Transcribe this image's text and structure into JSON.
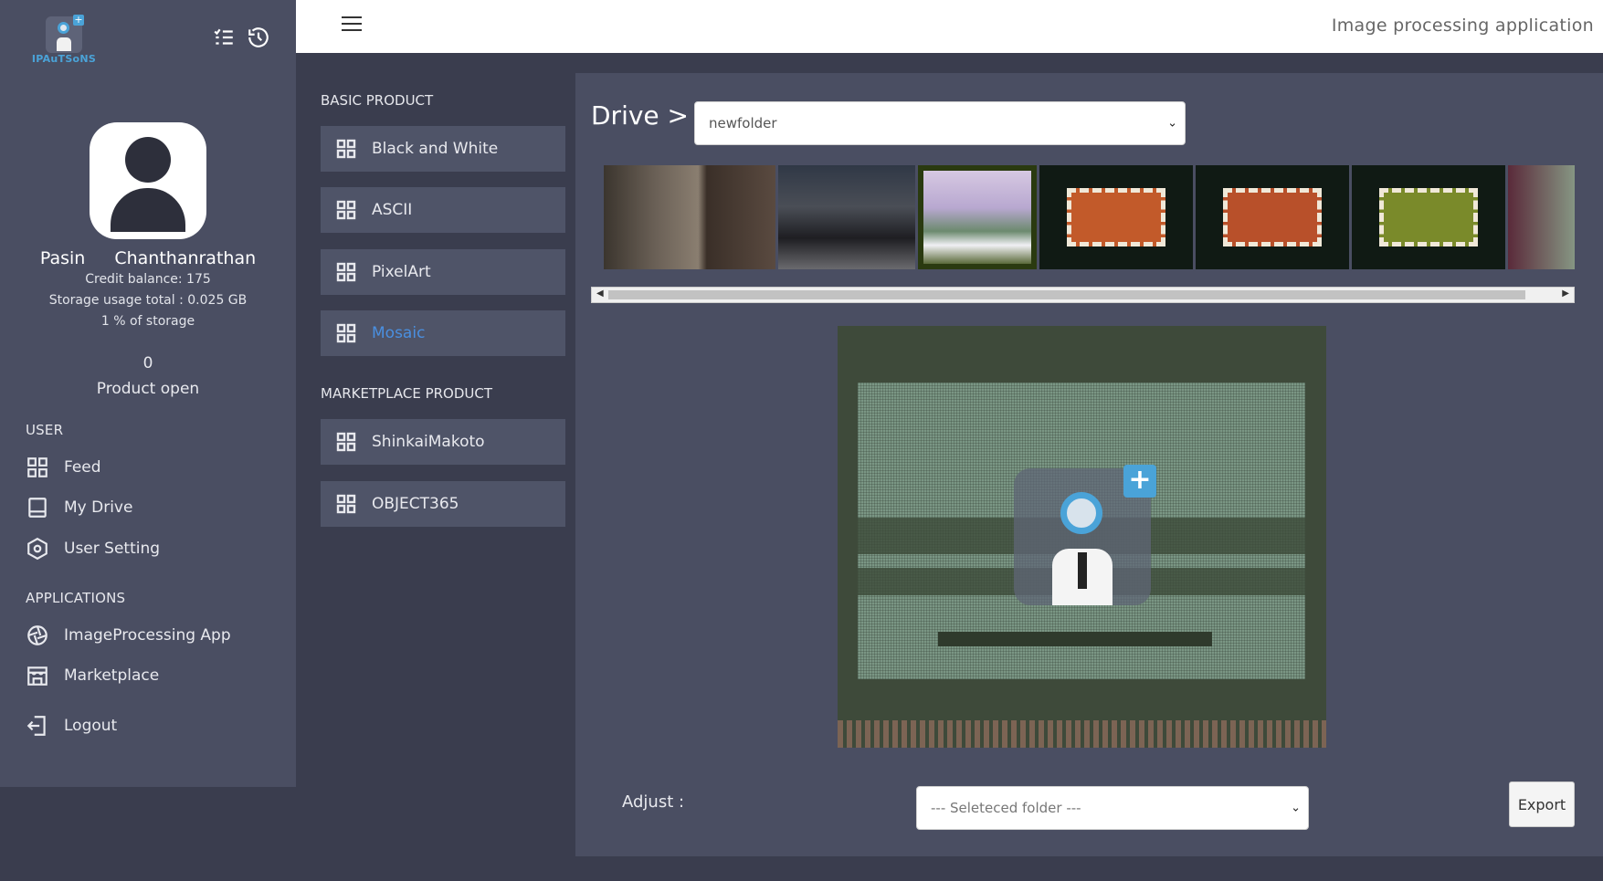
{
  "brand": {
    "logo_text": "IPAuTSoNS"
  },
  "header": {
    "title": "Image processing application"
  },
  "profile": {
    "first_name": "Pasin",
    "last_name": "Chanthanrathan",
    "credit": "Credit balance: 175",
    "storage_total": "Storage usage total : 0.025 GB",
    "storage_pct": "1 % of storage",
    "product_count": "0",
    "product_label": "Product open"
  },
  "nav": {
    "user_title": "USER",
    "user_items": [
      {
        "label": "Feed",
        "icon": "grid-icon"
      },
      {
        "label": "My Drive",
        "icon": "drive-icon"
      },
      {
        "label": "User Setting",
        "icon": "settings-hex-icon"
      }
    ],
    "apps_title": "APPLICATIONS",
    "app_items": [
      {
        "label": "ImageProcessing App",
        "icon": "aperture-icon"
      },
      {
        "label": "Marketplace",
        "icon": "store-icon"
      }
    ],
    "logout": "Logout"
  },
  "products": {
    "basic_title": "BASIC PRODUCT",
    "basic": [
      "Black and White",
      "ASCII",
      "PixelArt",
      "Mosaic"
    ],
    "active": "Mosaic",
    "market_title": "MARKETPLACE PRODUCT",
    "market": [
      "ShinkaiMakoto",
      "OBJECT365"
    ]
  },
  "drive": {
    "label": "Drive >",
    "folder": "newfolder"
  },
  "adjust": {
    "label": "Adjust :",
    "placeholder": "--- Seleteced folder ---",
    "export": "Export"
  },
  "colors": {
    "sidebar": "#4a4e62",
    "background": "#3a3d4e",
    "accent": "#4a8fe0"
  }
}
